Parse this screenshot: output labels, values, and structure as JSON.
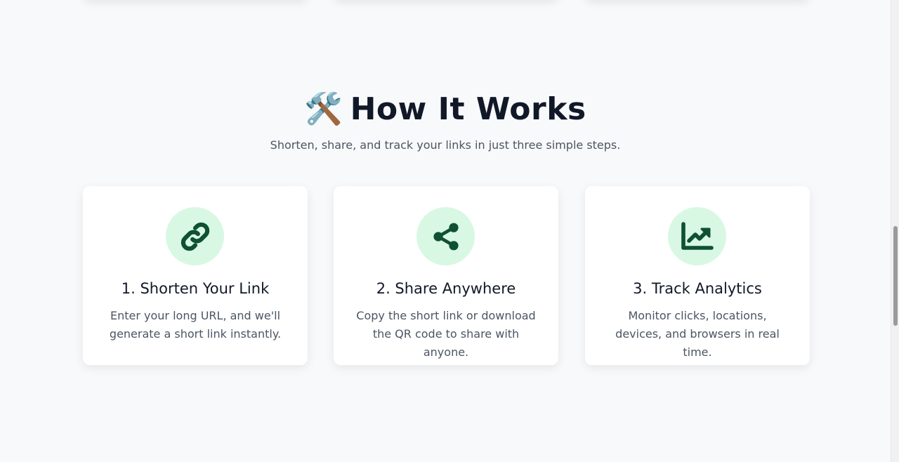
{
  "section": {
    "title_icon": "🛠️",
    "title": "How It Works",
    "subtitle": "Shorten, share, and track your links in just three simple steps."
  },
  "steps": [
    {
      "icon": "link-icon",
      "title": "1. Shorten Your Link",
      "description": "Enter your long URL, and we'll generate a short link instantly."
    },
    {
      "icon": "share-icon",
      "title": "2. Share Anywhere",
      "description": "Copy the short link or download the QR code to share with anyone."
    },
    {
      "icon": "chart-line-icon",
      "title": "3. Track Analytics",
      "description": "Monitor clicks, locations, devices, and browsers in real time."
    }
  ],
  "colors": {
    "icon_fg": "#0f5132",
    "icon_bg": "#d8f8e4",
    "heading": "#111827",
    "body_text": "#4b5563",
    "page_bg": "#f8f9fa"
  }
}
